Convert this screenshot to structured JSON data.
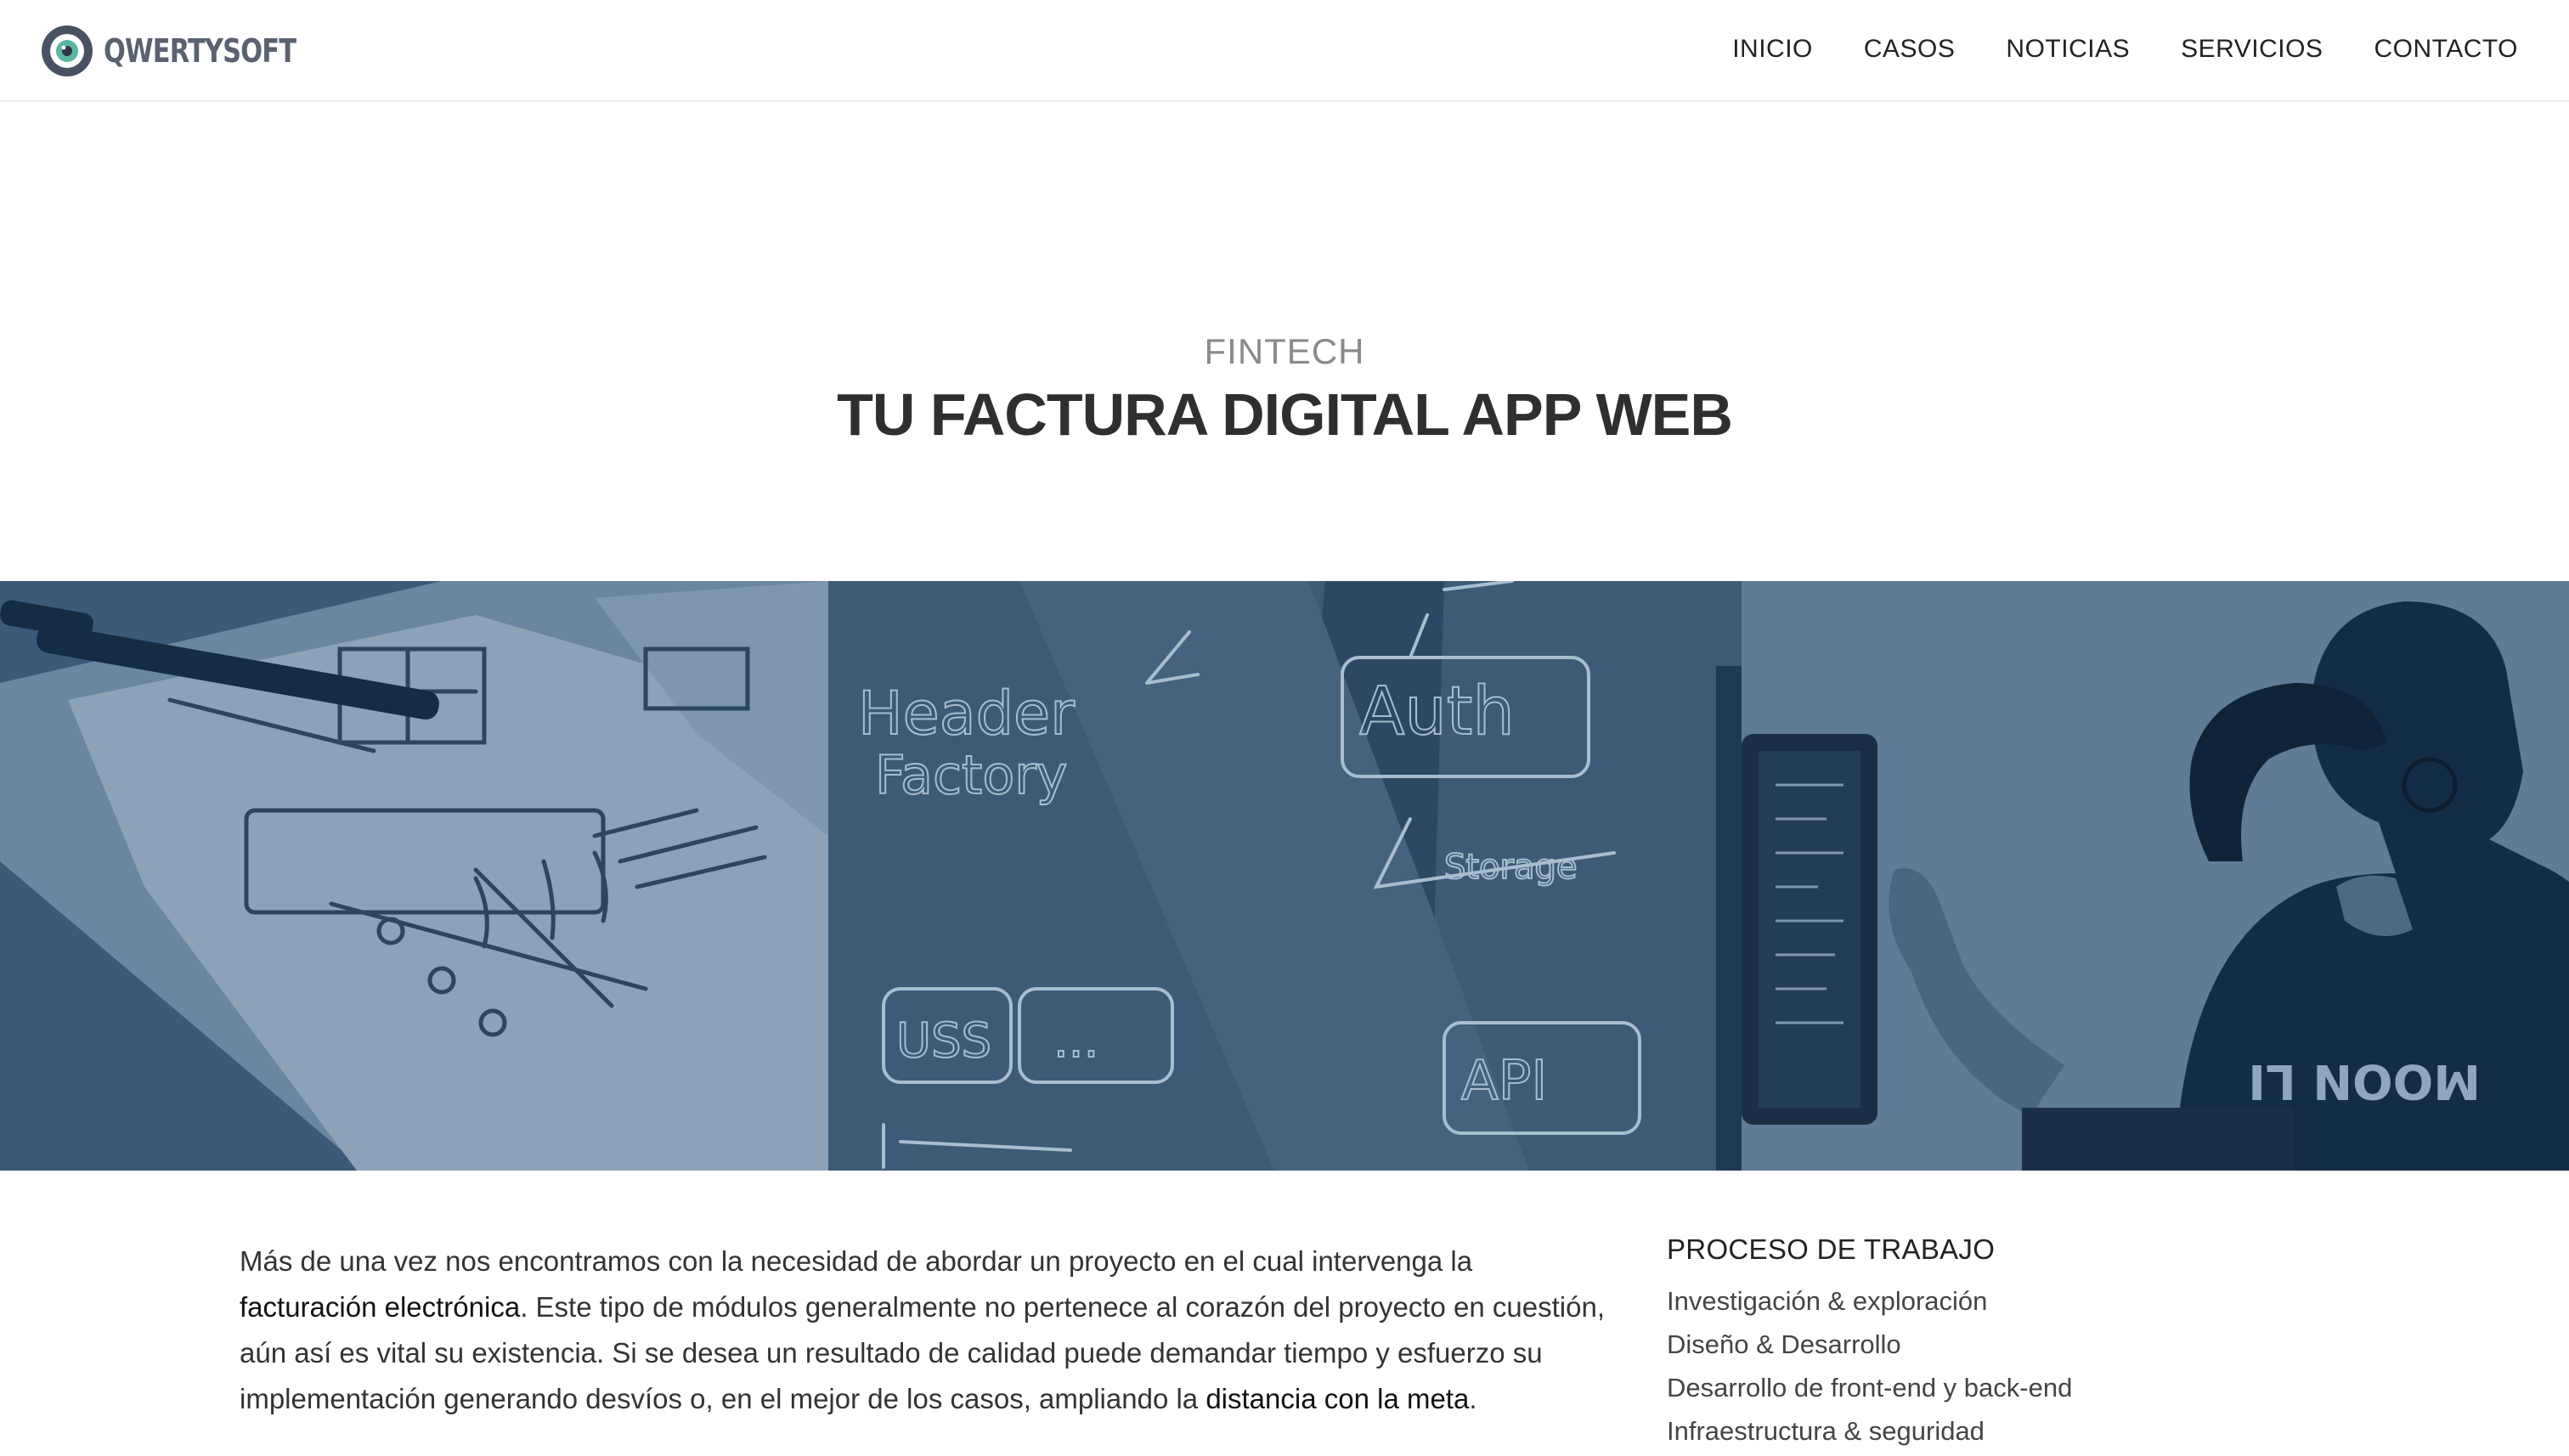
{
  "brand": {
    "name": "QWERTYSOFT",
    "color": "#4a5163",
    "accent": "#5bb6a2"
  },
  "nav": {
    "items": [
      {
        "label": "INICIO"
      },
      {
        "label": "CASOS"
      },
      {
        "label": "NOTICIAS"
      },
      {
        "label": "SERVICIOS"
      },
      {
        "label": "CONTACTO"
      }
    ]
  },
  "hero": {
    "eyebrow": "FINTECH",
    "title": "TU FACTURA DIGITAL APP WEB",
    "image_tint": "#2e4f6e"
  },
  "content": {
    "intro": [
      {
        "text": "Más de una vez nos encontramos con la necesidad de abordar un proyecto en el cual intervenga la ",
        "bold": false
      },
      {
        "text": "facturación electrónica",
        "bold": true
      },
      {
        "text": ". Este tipo de módulos generalmente no pertenece al corazón del proyecto en cuestión, aún así es vital su existencia. Si se desea un resultado de calidad puede demandar tiempo y esfuerzo su implementación generando desvíos o, en el mejor de los casos, ampliando la ",
        "bold": false
      },
      {
        "text": "distancia con la meta",
        "bold": true
      },
      {
        "text": ".",
        "bold": false
      }
    ]
  },
  "process": {
    "title": "PROCESO DE TRABAJO",
    "items": [
      "Investigación & exploración",
      "Diseño & Desarrollo",
      "Desarrollo de front-end y back-end",
      "Infraestructura & seguridad"
    ]
  }
}
